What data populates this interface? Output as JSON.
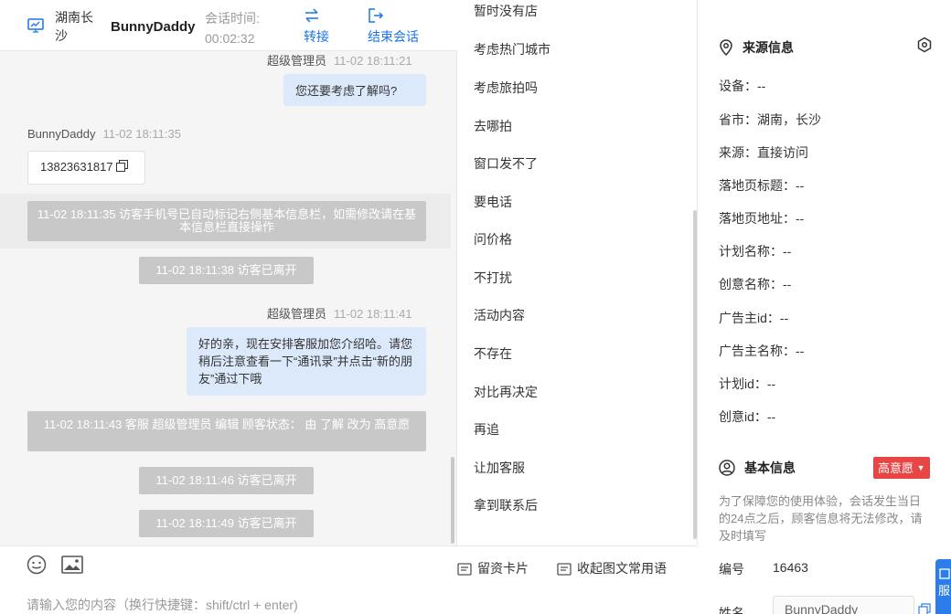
{
  "header": {
    "location": "湖南长沙",
    "visitor_name": "BunnyDaddy",
    "session_time_label": "会话时间:",
    "session_time": "00:02:32",
    "transfer_label": "转接",
    "end_label": "结束会话"
  },
  "messages": {
    "m1_sender": "超级管理员",
    "m1_time": "11-02 18:11:21",
    "m1_text": "您还要考虑了解吗?",
    "m2_sender": "BunnyDaddy",
    "m2_time": "11-02 18:11:35",
    "m2_text": "13823631817",
    "sys1": "11-02 18:11:35 访客手机号已自动标记右侧基本信息栏，如需修改请在基本信息栏直接操作",
    "sys2": "11-02 18:11:38 访客已离开",
    "m3_sender": "超级管理员",
    "m3_time": "11-02 18:11:41",
    "m3_text": "好的亲，现在安排客服加您介绍哈。请您稍后注意查看一下“通讯录”并点击“新的朋友”通过下哦",
    "sys3": "11-02 18:11:43 客服 超级管理员 编辑 顾客状态： 由 了解 改为 高意愿",
    "sys4": "11-02 18:11:46 访客已离开",
    "sys5": "11-02 18:11:49 访客已离开"
  },
  "composer": {
    "card_label": "留资卡片",
    "collapse_label": "收起图文常用语",
    "placeholder": "请输入您的内容（换行快捷键：shift/ctrl + enter)"
  },
  "quick_replies": [
    "暂时没有店",
    "考虑热门城市",
    "考虑旅拍吗",
    "去哪拍",
    "窗口发不了",
    "要电话",
    "问价格",
    "不打扰",
    "活动内容",
    "不存在",
    "对比再决定",
    "再追",
    "让加客服",
    "拿到联系后"
  ],
  "source_info": {
    "title": "来源信息",
    "rows": [
      "设备：--",
      "省市：湖南，长沙",
      "来源：直接访问",
      "落地页标题：--",
      "落地页地址：--",
      "计划名称：--",
      "创意名称：--",
      "广告主id：--",
      "广告主名称：--",
      "计划id：--",
      "创意id：--"
    ]
  },
  "basic_info": {
    "title": "基本信息",
    "level": "高意愿",
    "note": "为了保障您的使用体验，会话发生当日的24点之后，顾客信息将无法修改，请及时填写",
    "id_label": "编号",
    "id_value": "16463",
    "name_label": "姓名",
    "name_value": "BunnyDaddy",
    "float_tab": "服"
  },
  "colors": {
    "accent": "#1a73e8",
    "bubble_out": "#dce9fb",
    "system": "#c8c8c8",
    "badge": "#e84545"
  }
}
